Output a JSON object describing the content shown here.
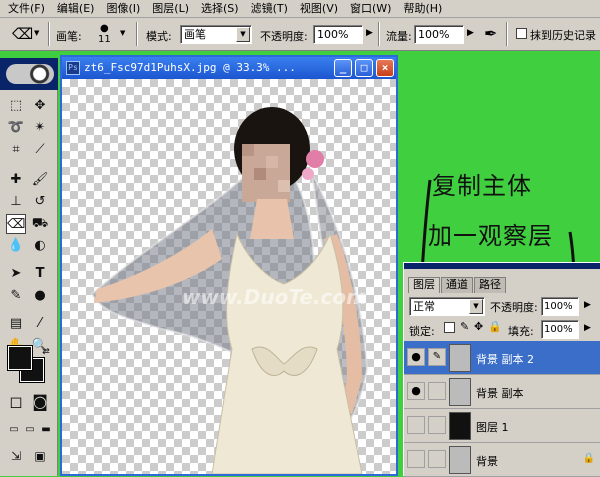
{
  "menu": [
    "文件(F)",
    "编辑(E)",
    "图像(I)",
    "图层(L)",
    "选择(S)",
    "滤镜(T)",
    "视图(V)",
    "窗口(W)",
    "帮助(H)"
  ],
  "options": {
    "brush_label": "画笔:",
    "brush_size": "11",
    "mode_label": "模式:",
    "mode_value": "画笔",
    "opacity_label": "不透明度:",
    "opacity_value": "100%",
    "flow_label": "流量:",
    "flow_value": "100%",
    "history_label": "抹到历史记录"
  },
  "document": {
    "title": "zt6_Fsc97d1PuhsX.jpg @ 33.3% ...",
    "watermark": "www.DuoTe.com"
  },
  "annotations": [
    "复制主体",
    "加一观察层"
  ],
  "layers": {
    "tabs": [
      "图层",
      "通道",
      "路径"
    ],
    "blend_mode": "正常",
    "opacity_label": "不透明度:",
    "opacity_value": "100%",
    "lock_label": "锁定:",
    "fill_label": "填充:",
    "fill_value": "100%",
    "rows": [
      {
        "name": "背景 副本 2",
        "selected": true,
        "visible": true
      },
      {
        "name": "背景 副本",
        "selected": false,
        "visible": true
      },
      {
        "name": "图层 1",
        "selected": false,
        "visible": false
      },
      {
        "name": "背景",
        "selected": false,
        "visible": false
      }
    ]
  },
  "colors": {
    "background": "#3fcf3f",
    "foreground_swatch": "#111111",
    "background_swatch": "#111111"
  }
}
